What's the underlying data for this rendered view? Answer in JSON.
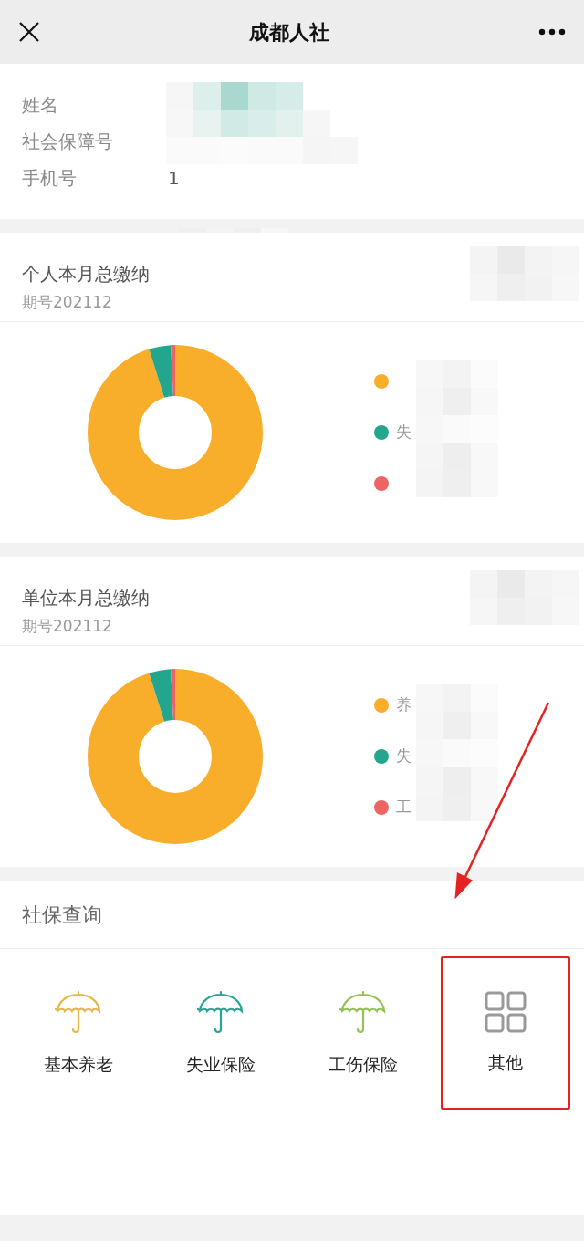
{
  "header": {
    "title": "成都人社"
  },
  "profile": {
    "rows": [
      {
        "label": "姓名"
      },
      {
        "label": "社会保障号"
      },
      {
        "label": "手机号",
        "value": "1"
      }
    ]
  },
  "cards": [
    {
      "title": "个人本月总缴纳",
      "period": "期号202112",
      "legend": [
        {
          "color": "#f9ae2b"
        },
        {
          "label": "失",
          "color": "#23a58e"
        },
        {
          "color": "#ed6464"
        }
      ]
    },
    {
      "title": "单位本月总缴纳",
      "period": "期号202112",
      "legend": [
        {
          "label": "养",
          "color": "#f9ae2b"
        },
        {
          "label": "失",
          "color": "#23a58e"
        },
        {
          "label": "工",
          "color": "#ed6464"
        }
      ]
    }
  ],
  "query": {
    "title": "社保查询",
    "items": [
      {
        "kind": "umbrella",
        "label": "基本养老",
        "color": "#e8b54a",
        "highlighted": false
      },
      {
        "kind": "umbrella",
        "label": "失业保险",
        "color": "#2aa595",
        "highlighted": false
      },
      {
        "kind": "umbrella",
        "label": "工伤保险",
        "color": "#93c254",
        "highlighted": false
      },
      {
        "kind": "grid",
        "label": "其他",
        "color": "#9a9a9a",
        "highlighted": true
      }
    ]
  }
}
